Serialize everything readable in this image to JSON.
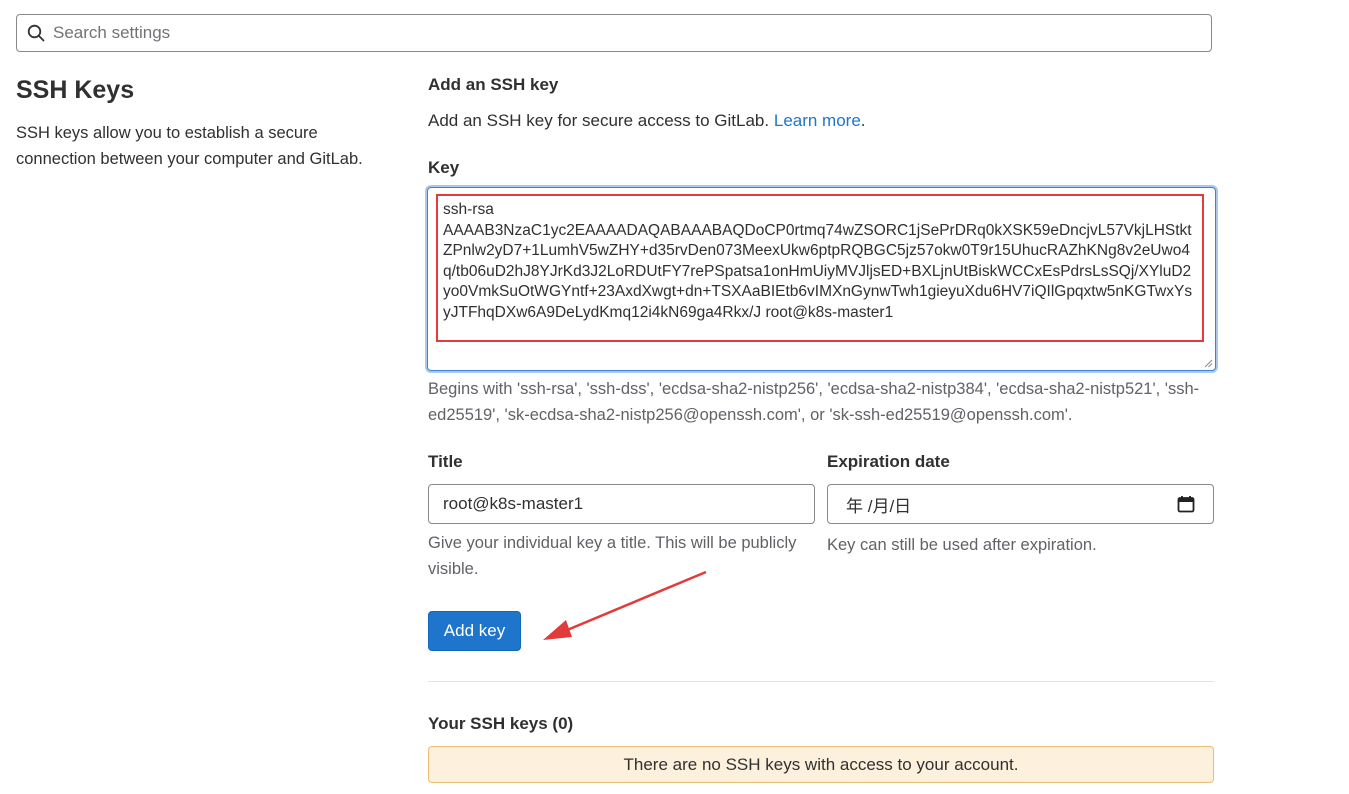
{
  "search": {
    "placeholder": "Search settings"
  },
  "section": {
    "title": "SSH Keys",
    "description": "SSH keys allow you to establish a secure connection between your computer and GitLab."
  },
  "add_key": {
    "heading": "Add an SSH key",
    "description": "Add an SSH key for secure access to GitLab.",
    "learn_more": "Learn more",
    "key_label": "Key",
    "key_value": "ssh-rsa\nAAAAB3NzaC1yc2EAAAADAQABAAABAQDoCP0rtmq74wZSORC1jSePrDRq0kXSK59eDncjvL57VkjLHStktZPnlw2yD7+1LumhV5wZHY+d35rvDen073MeexUkw6ptpRQBGC5jz57okw0T9r15UhucRAZhKNg8v2eUwo4q/tb06uD2hJ8YJrKd3J2LoRDUtFY7rePSpatsa1onHmUiyMVJljsED+BXLjnUtBiskWCCxEsPdrsLsSQj/XYluD2yo0VmkSuOtWGYntf+23AxdXwgt+dn+TSXAaBIEtb6vIMXnGynwTwh1gieyuXdu6HV7iQIlGpqxtw5nKGTwxYsyJTFhqDXw6A9DeLydKmq12i4kN69ga4Rkx/J root@k8s-master1",
    "key_help": "Begins with 'ssh-rsa', 'ssh-dss', 'ecdsa-sha2-nistp256', 'ecdsa-sha2-nistp384', 'ecdsa-sha2-nistp521', 'ssh-ed25519', 'sk-ecdsa-sha2-nistp256@openssh.com', or 'sk-ssh-ed25519@openssh.com'.",
    "title_label": "Title",
    "title_value": "root@k8s-master1",
    "title_help": "Give your individual key a title. This will be publicly visible.",
    "expiration_label": "Expiration date",
    "expiration_value": "年 /月/日",
    "expiration_help": "Key can still be used after expiration.",
    "button": "Add key"
  },
  "your_keys": {
    "heading": "Your SSH keys (0)",
    "empty_message": "There are no SSH keys with access to your account."
  },
  "colors": {
    "primary": "#1f75cb",
    "annotation": "#e23b3b",
    "alert_bg": "#fdf1dd",
    "alert_border": "#e9be74"
  }
}
